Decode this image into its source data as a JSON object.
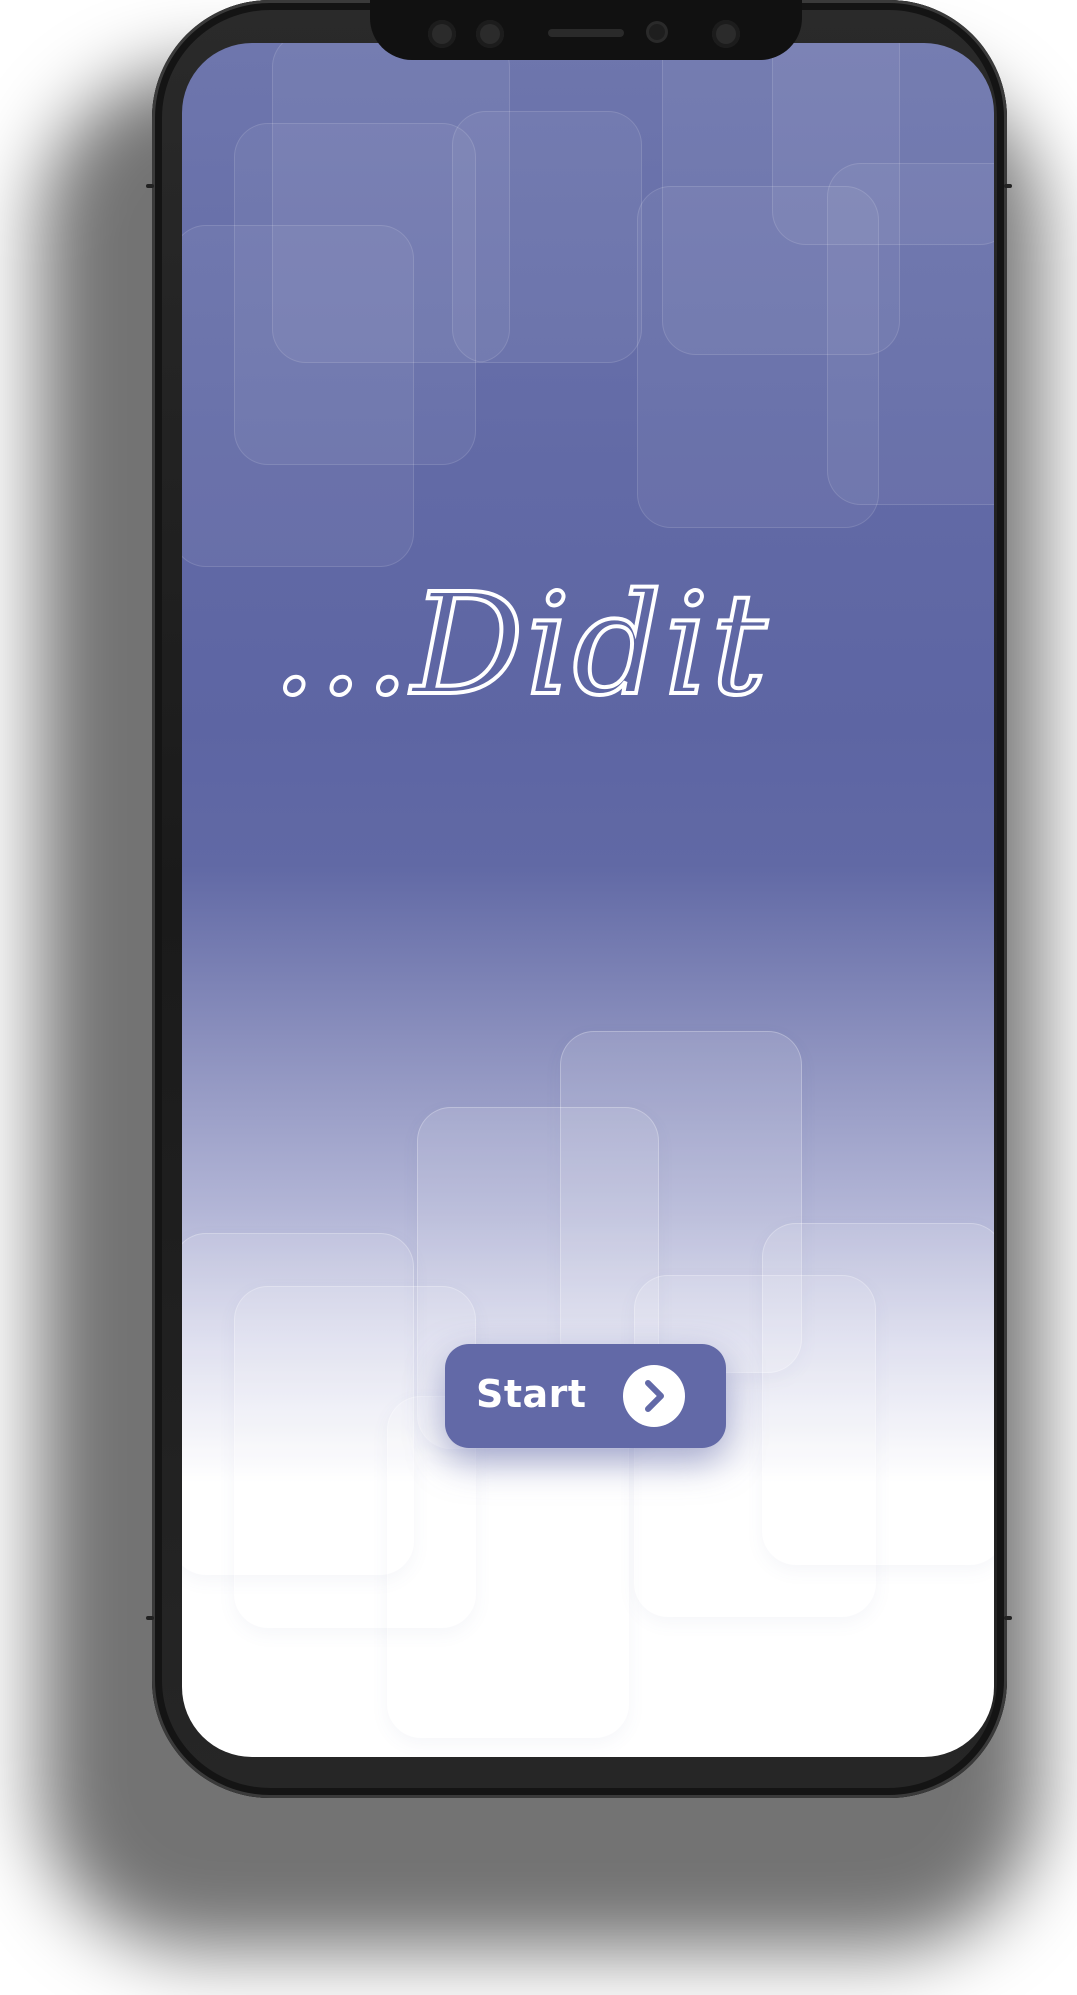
{
  "app": {
    "logo_text": "...Didit",
    "brand_color": "#6269a7"
  },
  "start_button": {
    "label": "Start",
    "icon": "chevron-right-icon"
  }
}
